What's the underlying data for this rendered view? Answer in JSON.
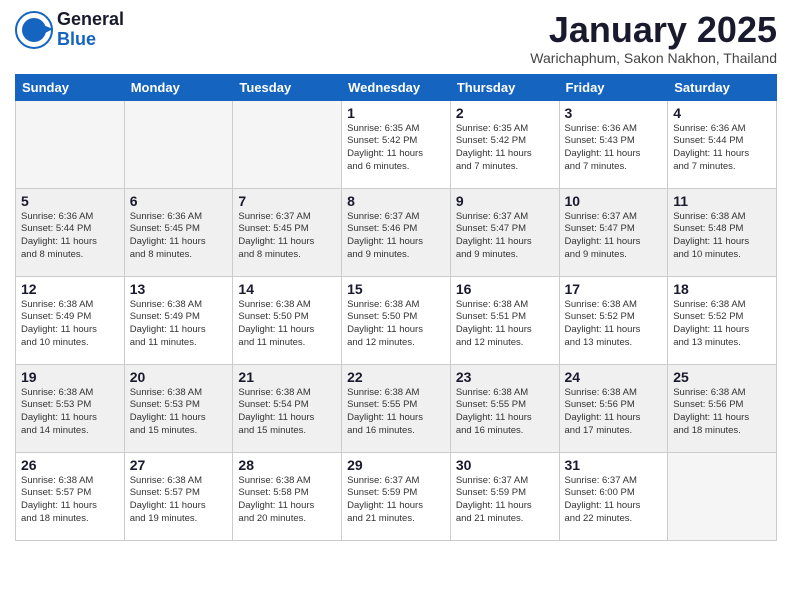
{
  "header": {
    "logo_general": "General",
    "logo_blue": "Blue",
    "month_title": "January 2025",
    "location": "Warichaphum, Sakon Nakhon, Thailand"
  },
  "weekdays": [
    "Sunday",
    "Monday",
    "Tuesday",
    "Wednesday",
    "Thursday",
    "Friday",
    "Saturday"
  ],
  "weeks": [
    [
      {
        "day": "",
        "info": "",
        "empty": true
      },
      {
        "day": "",
        "info": "",
        "empty": true
      },
      {
        "day": "",
        "info": "",
        "empty": true
      },
      {
        "day": "1",
        "info": "Sunrise: 6:35 AM\nSunset: 5:42 PM\nDaylight: 11 hours\nand 6 minutes."
      },
      {
        "day": "2",
        "info": "Sunrise: 6:35 AM\nSunset: 5:42 PM\nDaylight: 11 hours\nand 7 minutes."
      },
      {
        "day": "3",
        "info": "Sunrise: 6:36 AM\nSunset: 5:43 PM\nDaylight: 11 hours\nand 7 minutes."
      },
      {
        "day": "4",
        "info": "Sunrise: 6:36 AM\nSunset: 5:44 PM\nDaylight: 11 hours\nand 7 minutes."
      }
    ],
    [
      {
        "day": "5",
        "info": "Sunrise: 6:36 AM\nSunset: 5:44 PM\nDaylight: 11 hours\nand 8 minutes."
      },
      {
        "day": "6",
        "info": "Sunrise: 6:36 AM\nSunset: 5:45 PM\nDaylight: 11 hours\nand 8 minutes."
      },
      {
        "day": "7",
        "info": "Sunrise: 6:37 AM\nSunset: 5:45 PM\nDaylight: 11 hours\nand 8 minutes."
      },
      {
        "day": "8",
        "info": "Sunrise: 6:37 AM\nSunset: 5:46 PM\nDaylight: 11 hours\nand 9 minutes."
      },
      {
        "day": "9",
        "info": "Sunrise: 6:37 AM\nSunset: 5:47 PM\nDaylight: 11 hours\nand 9 minutes."
      },
      {
        "day": "10",
        "info": "Sunrise: 6:37 AM\nSunset: 5:47 PM\nDaylight: 11 hours\nand 9 minutes."
      },
      {
        "day": "11",
        "info": "Sunrise: 6:38 AM\nSunset: 5:48 PM\nDaylight: 11 hours\nand 10 minutes."
      }
    ],
    [
      {
        "day": "12",
        "info": "Sunrise: 6:38 AM\nSunset: 5:49 PM\nDaylight: 11 hours\nand 10 minutes."
      },
      {
        "day": "13",
        "info": "Sunrise: 6:38 AM\nSunset: 5:49 PM\nDaylight: 11 hours\nand 11 minutes."
      },
      {
        "day": "14",
        "info": "Sunrise: 6:38 AM\nSunset: 5:50 PM\nDaylight: 11 hours\nand 11 minutes."
      },
      {
        "day": "15",
        "info": "Sunrise: 6:38 AM\nSunset: 5:50 PM\nDaylight: 11 hours\nand 12 minutes."
      },
      {
        "day": "16",
        "info": "Sunrise: 6:38 AM\nSunset: 5:51 PM\nDaylight: 11 hours\nand 12 minutes."
      },
      {
        "day": "17",
        "info": "Sunrise: 6:38 AM\nSunset: 5:52 PM\nDaylight: 11 hours\nand 13 minutes."
      },
      {
        "day": "18",
        "info": "Sunrise: 6:38 AM\nSunset: 5:52 PM\nDaylight: 11 hours\nand 13 minutes."
      }
    ],
    [
      {
        "day": "19",
        "info": "Sunrise: 6:38 AM\nSunset: 5:53 PM\nDaylight: 11 hours\nand 14 minutes."
      },
      {
        "day": "20",
        "info": "Sunrise: 6:38 AM\nSunset: 5:53 PM\nDaylight: 11 hours\nand 15 minutes."
      },
      {
        "day": "21",
        "info": "Sunrise: 6:38 AM\nSunset: 5:54 PM\nDaylight: 11 hours\nand 15 minutes."
      },
      {
        "day": "22",
        "info": "Sunrise: 6:38 AM\nSunset: 5:55 PM\nDaylight: 11 hours\nand 16 minutes."
      },
      {
        "day": "23",
        "info": "Sunrise: 6:38 AM\nSunset: 5:55 PM\nDaylight: 11 hours\nand 16 minutes."
      },
      {
        "day": "24",
        "info": "Sunrise: 6:38 AM\nSunset: 5:56 PM\nDaylight: 11 hours\nand 17 minutes."
      },
      {
        "day": "25",
        "info": "Sunrise: 6:38 AM\nSunset: 5:56 PM\nDaylight: 11 hours\nand 18 minutes."
      }
    ],
    [
      {
        "day": "26",
        "info": "Sunrise: 6:38 AM\nSunset: 5:57 PM\nDaylight: 11 hours\nand 18 minutes."
      },
      {
        "day": "27",
        "info": "Sunrise: 6:38 AM\nSunset: 5:57 PM\nDaylight: 11 hours\nand 19 minutes."
      },
      {
        "day": "28",
        "info": "Sunrise: 6:38 AM\nSunset: 5:58 PM\nDaylight: 11 hours\nand 20 minutes."
      },
      {
        "day": "29",
        "info": "Sunrise: 6:37 AM\nSunset: 5:59 PM\nDaylight: 11 hours\nand 21 minutes."
      },
      {
        "day": "30",
        "info": "Sunrise: 6:37 AM\nSunset: 5:59 PM\nDaylight: 11 hours\nand 21 minutes."
      },
      {
        "day": "31",
        "info": "Sunrise: 6:37 AM\nSunset: 6:00 PM\nDaylight: 11 hours\nand 22 minutes."
      },
      {
        "day": "",
        "info": "",
        "empty": true
      }
    ]
  ]
}
